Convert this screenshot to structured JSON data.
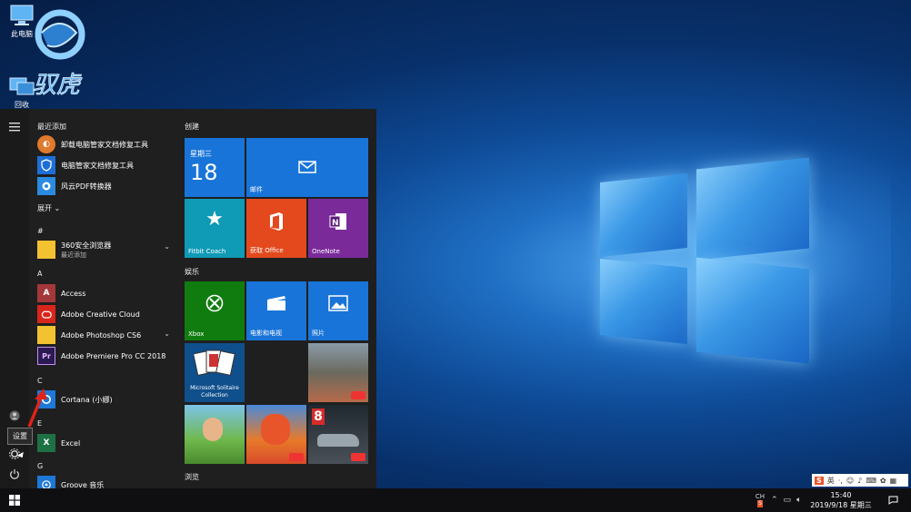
{
  "desktop": {
    "icons": [
      {
        "label": "此电脑",
        "icon": "computer-icon"
      },
      {
        "label": "回收",
        "icon": "network-icon"
      }
    ],
    "logo_text": "驭虎"
  },
  "start": {
    "rail": {
      "tooltip": "设置"
    },
    "recent_header": "最近添加",
    "recent": [
      {
        "label": "卸载电脑管家文档修复工具",
        "color": "#e07a2c"
      },
      {
        "label": "电脑管家文档修复工具",
        "color": "#1d6fd6"
      },
      {
        "label": "风云PDF转换器",
        "color": "#2a8be0"
      }
    ],
    "expand_label": "展开",
    "sections": {
      "hash": "#",
      "a": "A",
      "c": "C",
      "e": "E",
      "g": "G"
    },
    "apps": {
      "browser": {
        "label": "360安全浏览器",
        "sub": "最近添加"
      },
      "access": {
        "label": "Access",
        "letter": "A"
      },
      "adobe_cc": {
        "label": "Adobe Creative Cloud"
      },
      "photoshop": {
        "label": "Adobe Photoshop CS6"
      },
      "premiere": {
        "label": "Adobe Premiere Pro CC 2018",
        "letter": "Pr"
      },
      "cortana": {
        "label": "Cortana (小娜)"
      },
      "excel": {
        "label": "Excel",
        "letter": "X"
      },
      "groove": {
        "label": "Groove 音乐"
      }
    },
    "groups": {
      "create": "创建",
      "play": "娱乐",
      "browse": "浏览"
    },
    "tiles": {
      "calendar": {
        "day_name": "星期三",
        "day": "18"
      },
      "mail": {
        "label": "邮件"
      },
      "fitbit": {
        "label": "Fitbit Coach"
      },
      "office": {
        "label": "获取 Office"
      },
      "onenote": {
        "label": "OneNote"
      },
      "xbox": {
        "label": "Xbox"
      },
      "movies": {
        "label": "电影和电视"
      },
      "photos": {
        "label": "照片"
      },
      "solitaire": {
        "label": "Microsoft Solitaire Collection"
      }
    }
  },
  "taskbar": {
    "lang": "CH",
    "time": "15:40",
    "date": "2019/9/18 星期三",
    "ime": "英"
  },
  "colors": {
    "tile_blue": "#1874d8",
    "tile_teal": "#0f9ab6",
    "tile_orange": "#e3491d",
    "tile_purple": "#7b2a9a",
    "tile_green": "#107c10",
    "arrow_red": "#e0231a"
  }
}
